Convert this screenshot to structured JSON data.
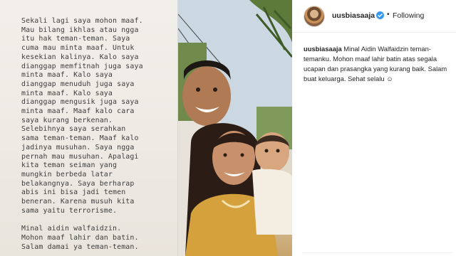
{
  "post": {
    "image_text_lines": [
      "Sekali lagi saya mohon maaf.",
      "Mau bilang ikhlas atau ngga",
      "itu hak teman-teman. Saya",
      "cuma mau minta maaf. Untuk",
      "kesekian kalinya. Kalo saya",
      "dianggap memfitnah juga saya",
      "minta maaf. Kalo saya",
      "dianggap menuduh juga saya",
      "minta maaf. Kalo saya",
      "dianggap mengusik juga saya",
      "minta maaf. Maaf kalo cara",
      "saya kurang berkenan.",
      "Selebihnya saya serahkan",
      "sama teman-teman. Maaf kalo",
      "jadinya musuhan. Saya ngga",
      "pernah mau musuhan. Apalagi",
      "kita teman seiman yang",
      "mungkin berbeda latar",
      "belakangnya. Saya berharap",
      "abis ini bisa jadi temen",
      "beneran. Karena musuh kita",
      "sama yaitu terrorisme.",
      "",
      "Minal aidin walfaidzin.",
      "Mohon maaf lahir dan batin.",
      "Salam damai ya teman-teman."
    ]
  },
  "sidebar": {
    "username": "uusbiasaaja",
    "separator": "•",
    "follow_status": "Following",
    "caption_user": "uusbiasaaja",
    "caption_text": "Minal Aidin Walfaidzin teman-temanku. Mohon maaf lahir batin atas segala ucapan dan prasangka yang kurang baik. Salam buat keluarga. Sehat selalu ☺"
  },
  "colors": {
    "verified": "#3897f0",
    "text": "#262626",
    "panel_bg": "#efebe6"
  },
  "icons": {
    "verified": "verified-badge-icon",
    "avatar": "profile-avatar"
  }
}
